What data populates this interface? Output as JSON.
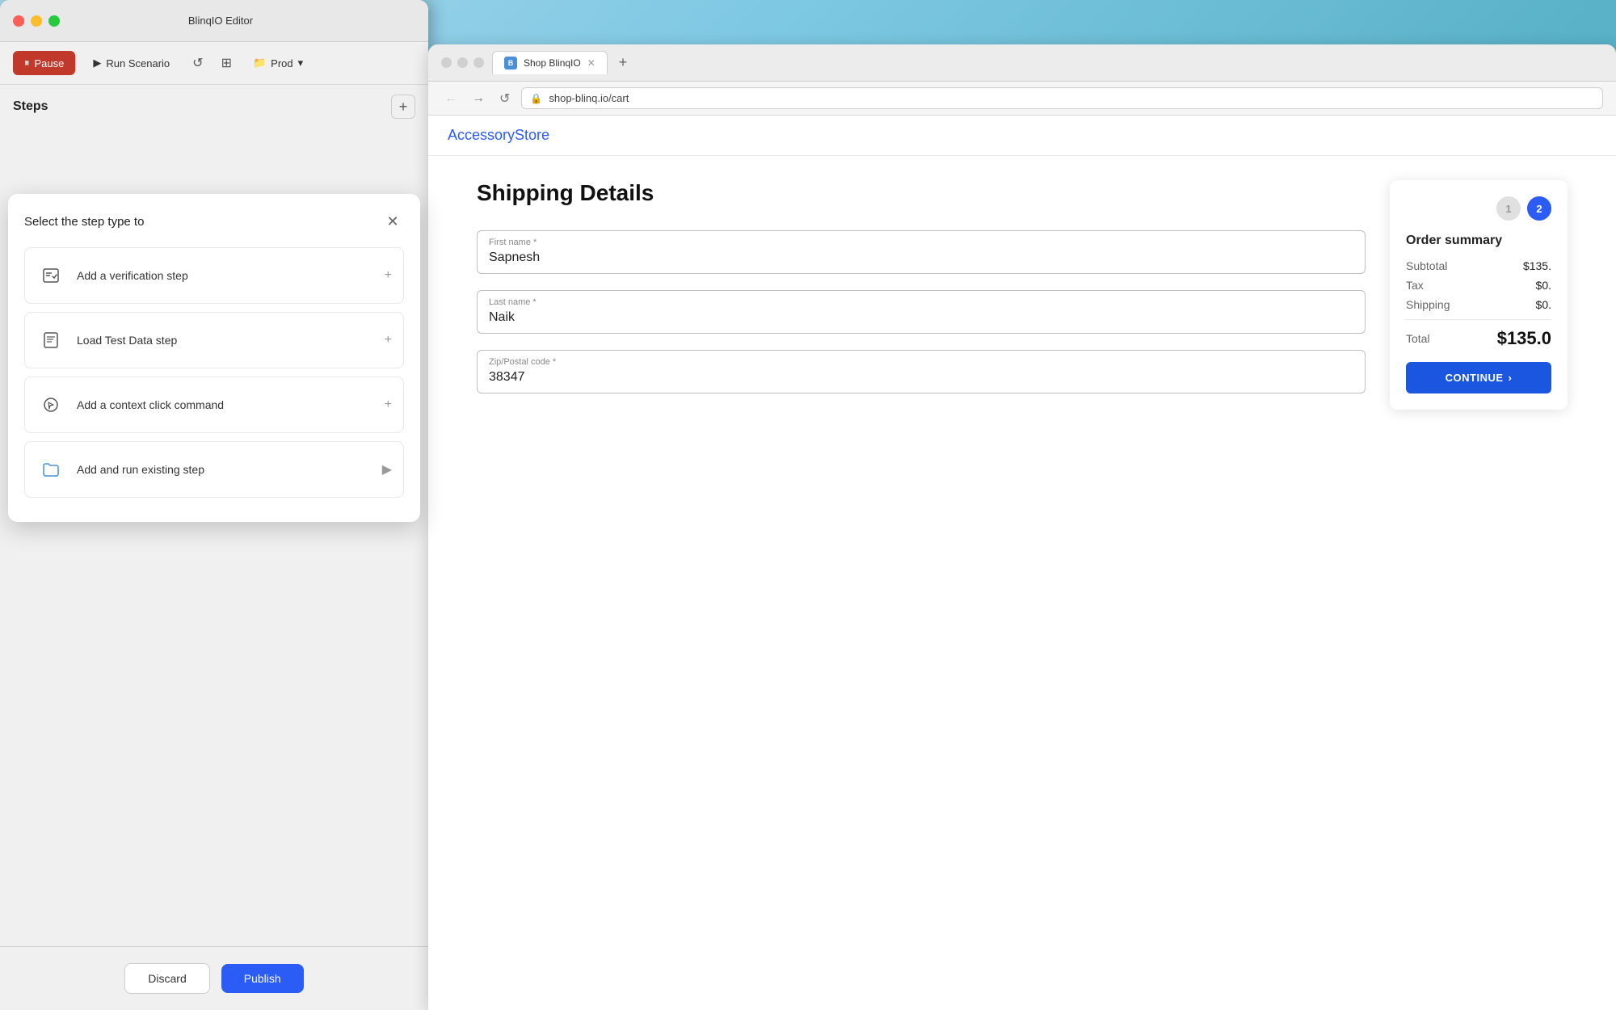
{
  "macos": {
    "title": "BlinqIO Editor",
    "trafficLights": [
      "red",
      "yellow",
      "green"
    ]
  },
  "toolbar": {
    "pause_label": "Pause",
    "run_scenario_label": "Run Scenario",
    "env_label": "Prod"
  },
  "steps": {
    "title": "Steps"
  },
  "dropdown": {
    "title": "Select the step type to",
    "options": [
      {
        "label": "Add a verification step",
        "icon": "verify-icon",
        "action": "plus"
      },
      {
        "label": "Load Test Data step",
        "icon": "load-data-icon",
        "action": "plus"
      },
      {
        "label": "Add a context click command",
        "icon": "context-click-icon",
        "action": "plus"
      },
      {
        "label": "Add and run existing step",
        "icon": "folder-icon",
        "action": "arrow"
      }
    ]
  },
  "footer": {
    "discard_label": "Discard",
    "publish_label": "Publish"
  },
  "browser": {
    "tab_label": "Shop BlinqIO",
    "url": "shop-blinq.io/cart",
    "site_brand_plain": "Accessory",
    "site_brand_colored": "Store"
  },
  "shipping": {
    "heading": "Shipping Details",
    "first_name_label": "First name *",
    "first_name_value": "Sapnesh",
    "last_name_label": "Last name *",
    "last_name_value": "Naik",
    "zip_label": "Zip/Postal code *",
    "zip_value": "38347"
  },
  "order": {
    "title": "Order summary",
    "subtotal_label": "Subtotal",
    "subtotal_value": "$135.",
    "tax_label": "Tax",
    "tax_value": "$0.",
    "shipping_label": "Shipping",
    "shipping_value": "$0.",
    "total_label": "Total",
    "total_value": "$135.0",
    "continue_label": "CONTINUE",
    "step1": "1",
    "step2": "2"
  }
}
